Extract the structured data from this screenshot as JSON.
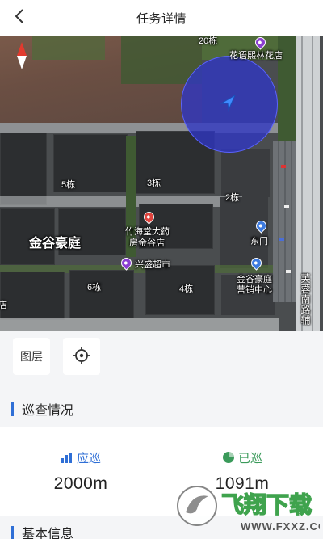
{
  "header": {
    "title": "任务详情",
    "back_icon": "chevron-left-icon"
  },
  "map": {
    "compass_icon": "compass-needle-icon",
    "location_icon": "navigation-arrow-icon",
    "coverage_color": "#3036c4",
    "labels": {
      "building_20": "20栋",
      "flower_shop": "花语熙林花店",
      "building_5": "5栋",
      "building_3": "3栋",
      "building_2": "2栋",
      "community": "金谷豪庭",
      "pharmacy_line1": "竹海堂大药",
      "pharmacy_line2": "房金谷店",
      "east_gate": "东门",
      "supermarket": "兴盛超市",
      "sales_line1": "金谷豪庭",
      "sales_line2": "营销中心",
      "building_6": "6栋",
      "building_4": "4栋",
      "road_vertical": "芙蓉南路辅",
      "left_clipped": "店"
    },
    "pin_colors": {
      "flower_shop": "#8b3fd1",
      "pharmacy": "#e0443e",
      "east_gate": "#3d7be0",
      "supermarket": "#8b3fd1",
      "sales": "#3d7be0"
    }
  },
  "controls": {
    "layers_label": "图层",
    "locate_icon": "crosshair-icon"
  },
  "patrol_section": {
    "title": "巡查情况",
    "accent_color": "#2f6fd6",
    "should": {
      "label": "应巡",
      "value": "2000m",
      "icon": "bar-chart-icon",
      "color": "#2f6fd6"
    },
    "done": {
      "label": "已巡",
      "value": "1091m",
      "icon": "pie-chart-icon",
      "color": "#3a9a5a"
    }
  },
  "basic_section": {
    "title": "基本信息"
  },
  "watermark": {
    "logo_text": "飞翔下载",
    "logo_url_text": "WWW.FXXZ.COM"
  }
}
